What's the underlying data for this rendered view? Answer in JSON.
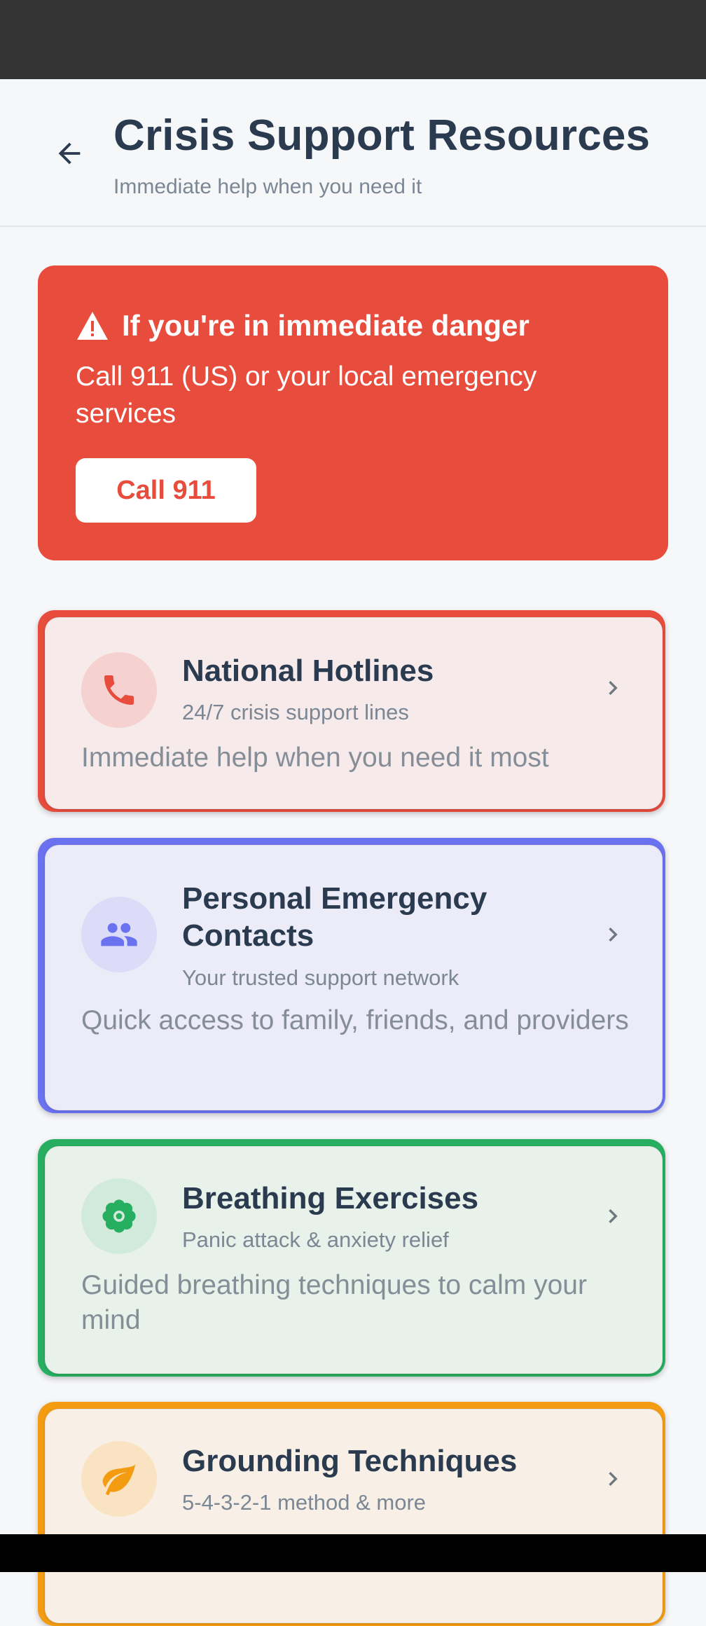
{
  "header": {
    "title": "Crisis Support Resources",
    "subtitle": "Immediate help when you need it"
  },
  "danger": {
    "title": "If you're in immediate danger",
    "text": "Call 911 (US) or your local emergency services",
    "button_label": "Call 911",
    "color": "#e74c3c"
  },
  "resources": [
    {
      "title": "National Hotlines",
      "subtitle": "24/7 crisis support lines",
      "description": "Immediate help when you need it most",
      "icon": "phone-icon",
      "accent": "#e74c3c",
      "background": "#f7eaea"
    },
    {
      "title": "Personal Emergency Contacts",
      "subtitle": "Your trusted support network",
      "description": "Quick access to family, friends, and providers",
      "icon": "people-icon",
      "accent": "#6b72f0",
      "background": "#ececf8"
    },
    {
      "title": "Breathing Exercises",
      "subtitle": "Panic attack & anxiety relief",
      "description": "Guided breathing techniques to calm your mind",
      "icon": "flower-icon",
      "accent": "#27ae60",
      "background": "#e8f1ea"
    },
    {
      "title": "Grounding Techniques",
      "subtitle": "5-4-3-2-1 method & more",
      "description": "",
      "icon": "leaf-icon",
      "accent": "#f39c12",
      "background": "#f8f0e6"
    }
  ]
}
